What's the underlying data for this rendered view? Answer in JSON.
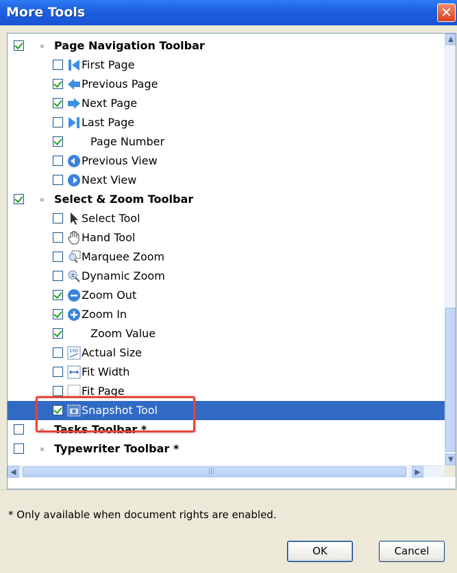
{
  "window": {
    "title": "More Tools",
    "close_glyph": "✕"
  },
  "tree": [
    {
      "label": "Page Navigation Toolbar",
      "checked": true,
      "level": 0,
      "icon": "none"
    },
    {
      "label": "First Page",
      "checked": false,
      "level": 1,
      "icon": "first-page-icon"
    },
    {
      "label": "Previous Page",
      "checked": true,
      "level": 1,
      "icon": "previous-page-icon"
    },
    {
      "label": "Next Page",
      "checked": true,
      "level": 1,
      "icon": "next-page-icon"
    },
    {
      "label": "Last Page",
      "checked": false,
      "level": 1,
      "icon": "last-page-icon"
    },
    {
      "label": "Page Number",
      "checked": true,
      "level": 1,
      "icon": "none"
    },
    {
      "label": "Previous View",
      "checked": false,
      "level": 1,
      "icon": "previous-view-icon"
    },
    {
      "label": "Next View",
      "checked": false,
      "level": 1,
      "icon": "next-view-icon"
    },
    {
      "label": "Select & Zoom Toolbar",
      "checked": true,
      "level": 0,
      "icon": "none"
    },
    {
      "label": "Select Tool",
      "checked": false,
      "level": 1,
      "icon": "select-arrow-icon"
    },
    {
      "label": "Hand Tool",
      "checked": false,
      "level": 1,
      "icon": "hand-icon"
    },
    {
      "label": "Marquee Zoom",
      "checked": false,
      "level": 1,
      "icon": "marquee-zoom-icon"
    },
    {
      "label": "Dynamic Zoom",
      "checked": false,
      "level": 1,
      "icon": "dynamic-zoom-icon"
    },
    {
      "label": "Zoom Out",
      "checked": true,
      "level": 1,
      "icon": "zoom-out-icon"
    },
    {
      "label": "Zoom In",
      "checked": true,
      "level": 1,
      "icon": "zoom-in-icon"
    },
    {
      "label": "Zoom Value",
      "checked": true,
      "level": 1,
      "icon": "none"
    },
    {
      "label": "Actual Size",
      "checked": false,
      "level": 1,
      "icon": "actual-size-icon"
    },
    {
      "label": "Fit Width",
      "checked": false,
      "level": 1,
      "icon": "fit-width-icon"
    },
    {
      "label": "Fit Page",
      "checked": false,
      "level": 1,
      "icon": "fit-page-icon"
    },
    {
      "label": "Snapshot Tool",
      "checked": true,
      "level": 1,
      "icon": "snapshot-camera-icon",
      "selected": true
    },
    {
      "label": "Tasks Toolbar *",
      "checked": false,
      "level": 0,
      "icon": "none"
    },
    {
      "label": "Typewriter Toolbar *",
      "checked": false,
      "level": 0,
      "icon": "none"
    }
  ],
  "footer": {
    "note": "* Only available when document rights are enabled."
  },
  "buttons": {
    "ok": "OK",
    "cancel": "Cancel"
  },
  "colors": {
    "title_bar": "#1c5fdf",
    "selection": "#316ac5",
    "highlight_box": "#e0463b",
    "check": "#21a121"
  },
  "scrollbar_glyphs": {
    "up": "▲",
    "down": "▼",
    "left": "◀",
    "right": "▶",
    "grip": "|||"
  }
}
